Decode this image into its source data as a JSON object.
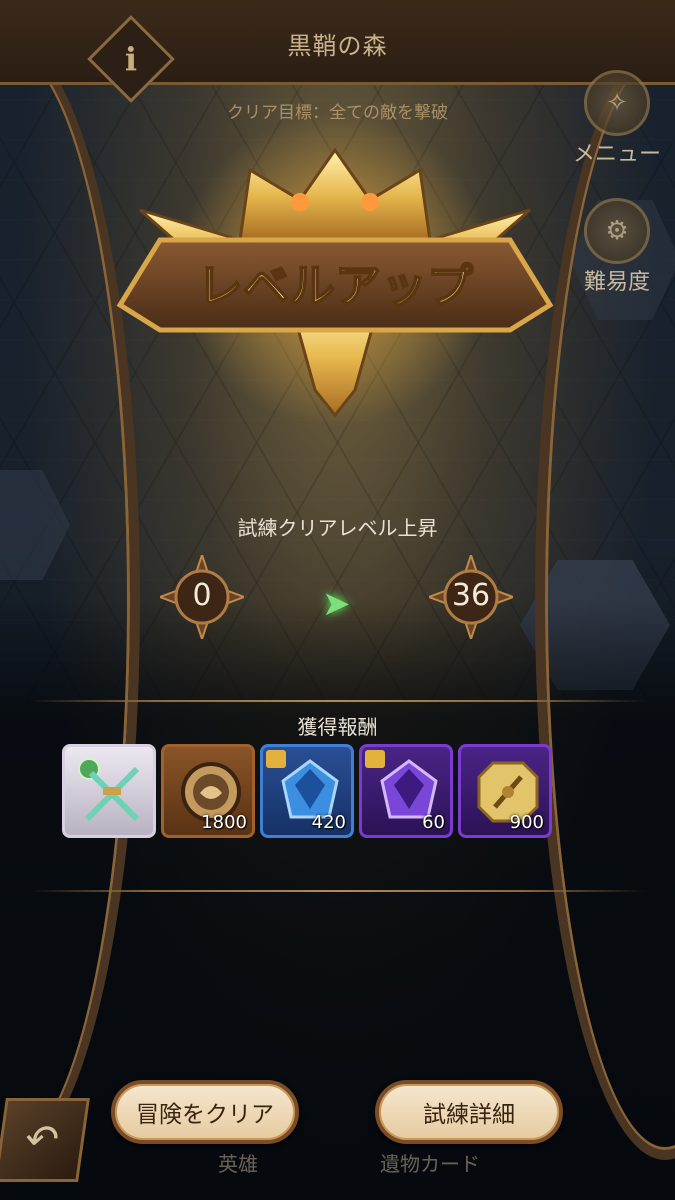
{
  "header": {
    "title": "黒鞘の森",
    "goal": "クリア目標：全ての敵を撃破",
    "info_label": "i"
  },
  "side_menu": {
    "menu_label": "メニュー",
    "difficulty_label": "難易度"
  },
  "level_up": {
    "banner": "レベルアップ",
    "subtitle": "試練クリアレベル上昇",
    "from_level": "0",
    "to_level": "36"
  },
  "rewards": {
    "title": "獲得報酬",
    "items": [
      {
        "icon": "jade-swords-icon",
        "quantity": "",
        "frame_color": "#cfc7d6"
      },
      {
        "icon": "bronze-medal-icon",
        "quantity": "1800",
        "frame_color": "#a0612a"
      },
      {
        "icon": "blue-crystal-icon",
        "quantity": "420",
        "frame_color": "#3f7fd6"
      },
      {
        "icon": "purple-crystal-icon",
        "quantity": "60",
        "frame_color": "#7a3bd0"
      },
      {
        "icon": "gold-token-icon",
        "quantity": "900",
        "frame_color": "#7a3bd0"
      }
    ]
  },
  "footer": {
    "clear_adventure": "冒険をクリア",
    "trial_details": "試練詳細",
    "hero_tab": "英雄",
    "relic_tab": "遺物カード",
    "back_icon": "↶"
  },
  "colors": {
    "accent_gold": "#d9a74a",
    "arrow_green": "#7de07a",
    "button_bg": "#f2e0c2"
  }
}
